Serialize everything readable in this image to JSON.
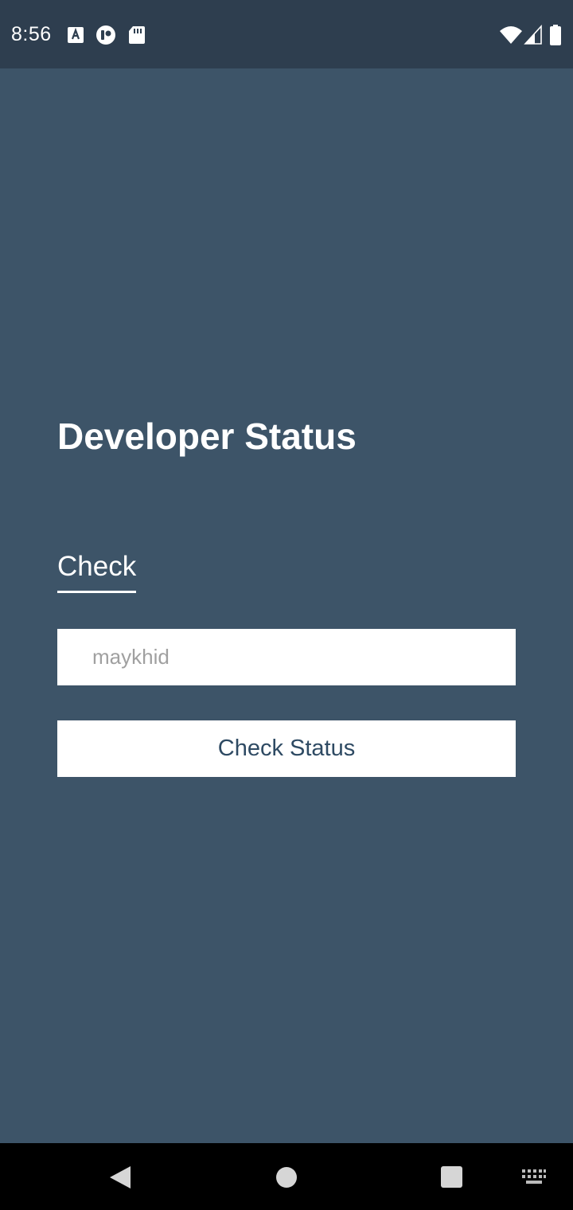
{
  "status_bar": {
    "time": "8:56",
    "icons": [
      "accessibility-a-icon",
      "notification-app-icon",
      "sd-card-icon",
      "wifi-icon",
      "signal-icon",
      "battery-icon"
    ]
  },
  "main": {
    "title": "Developer Status",
    "tab_label": "Check",
    "username_input": {
      "value": "",
      "placeholder": "maykhid"
    },
    "check_button_label": "Check Status"
  },
  "nav_bar": {
    "buttons": [
      "back-icon",
      "home-icon",
      "recents-icon",
      "keyboard-icon"
    ]
  },
  "colors": {
    "background": "#3d5468",
    "status_bar": "#2e3e4f",
    "button_text": "#2e4a63",
    "white": "#ffffff",
    "nav_bar": "#000000"
  }
}
